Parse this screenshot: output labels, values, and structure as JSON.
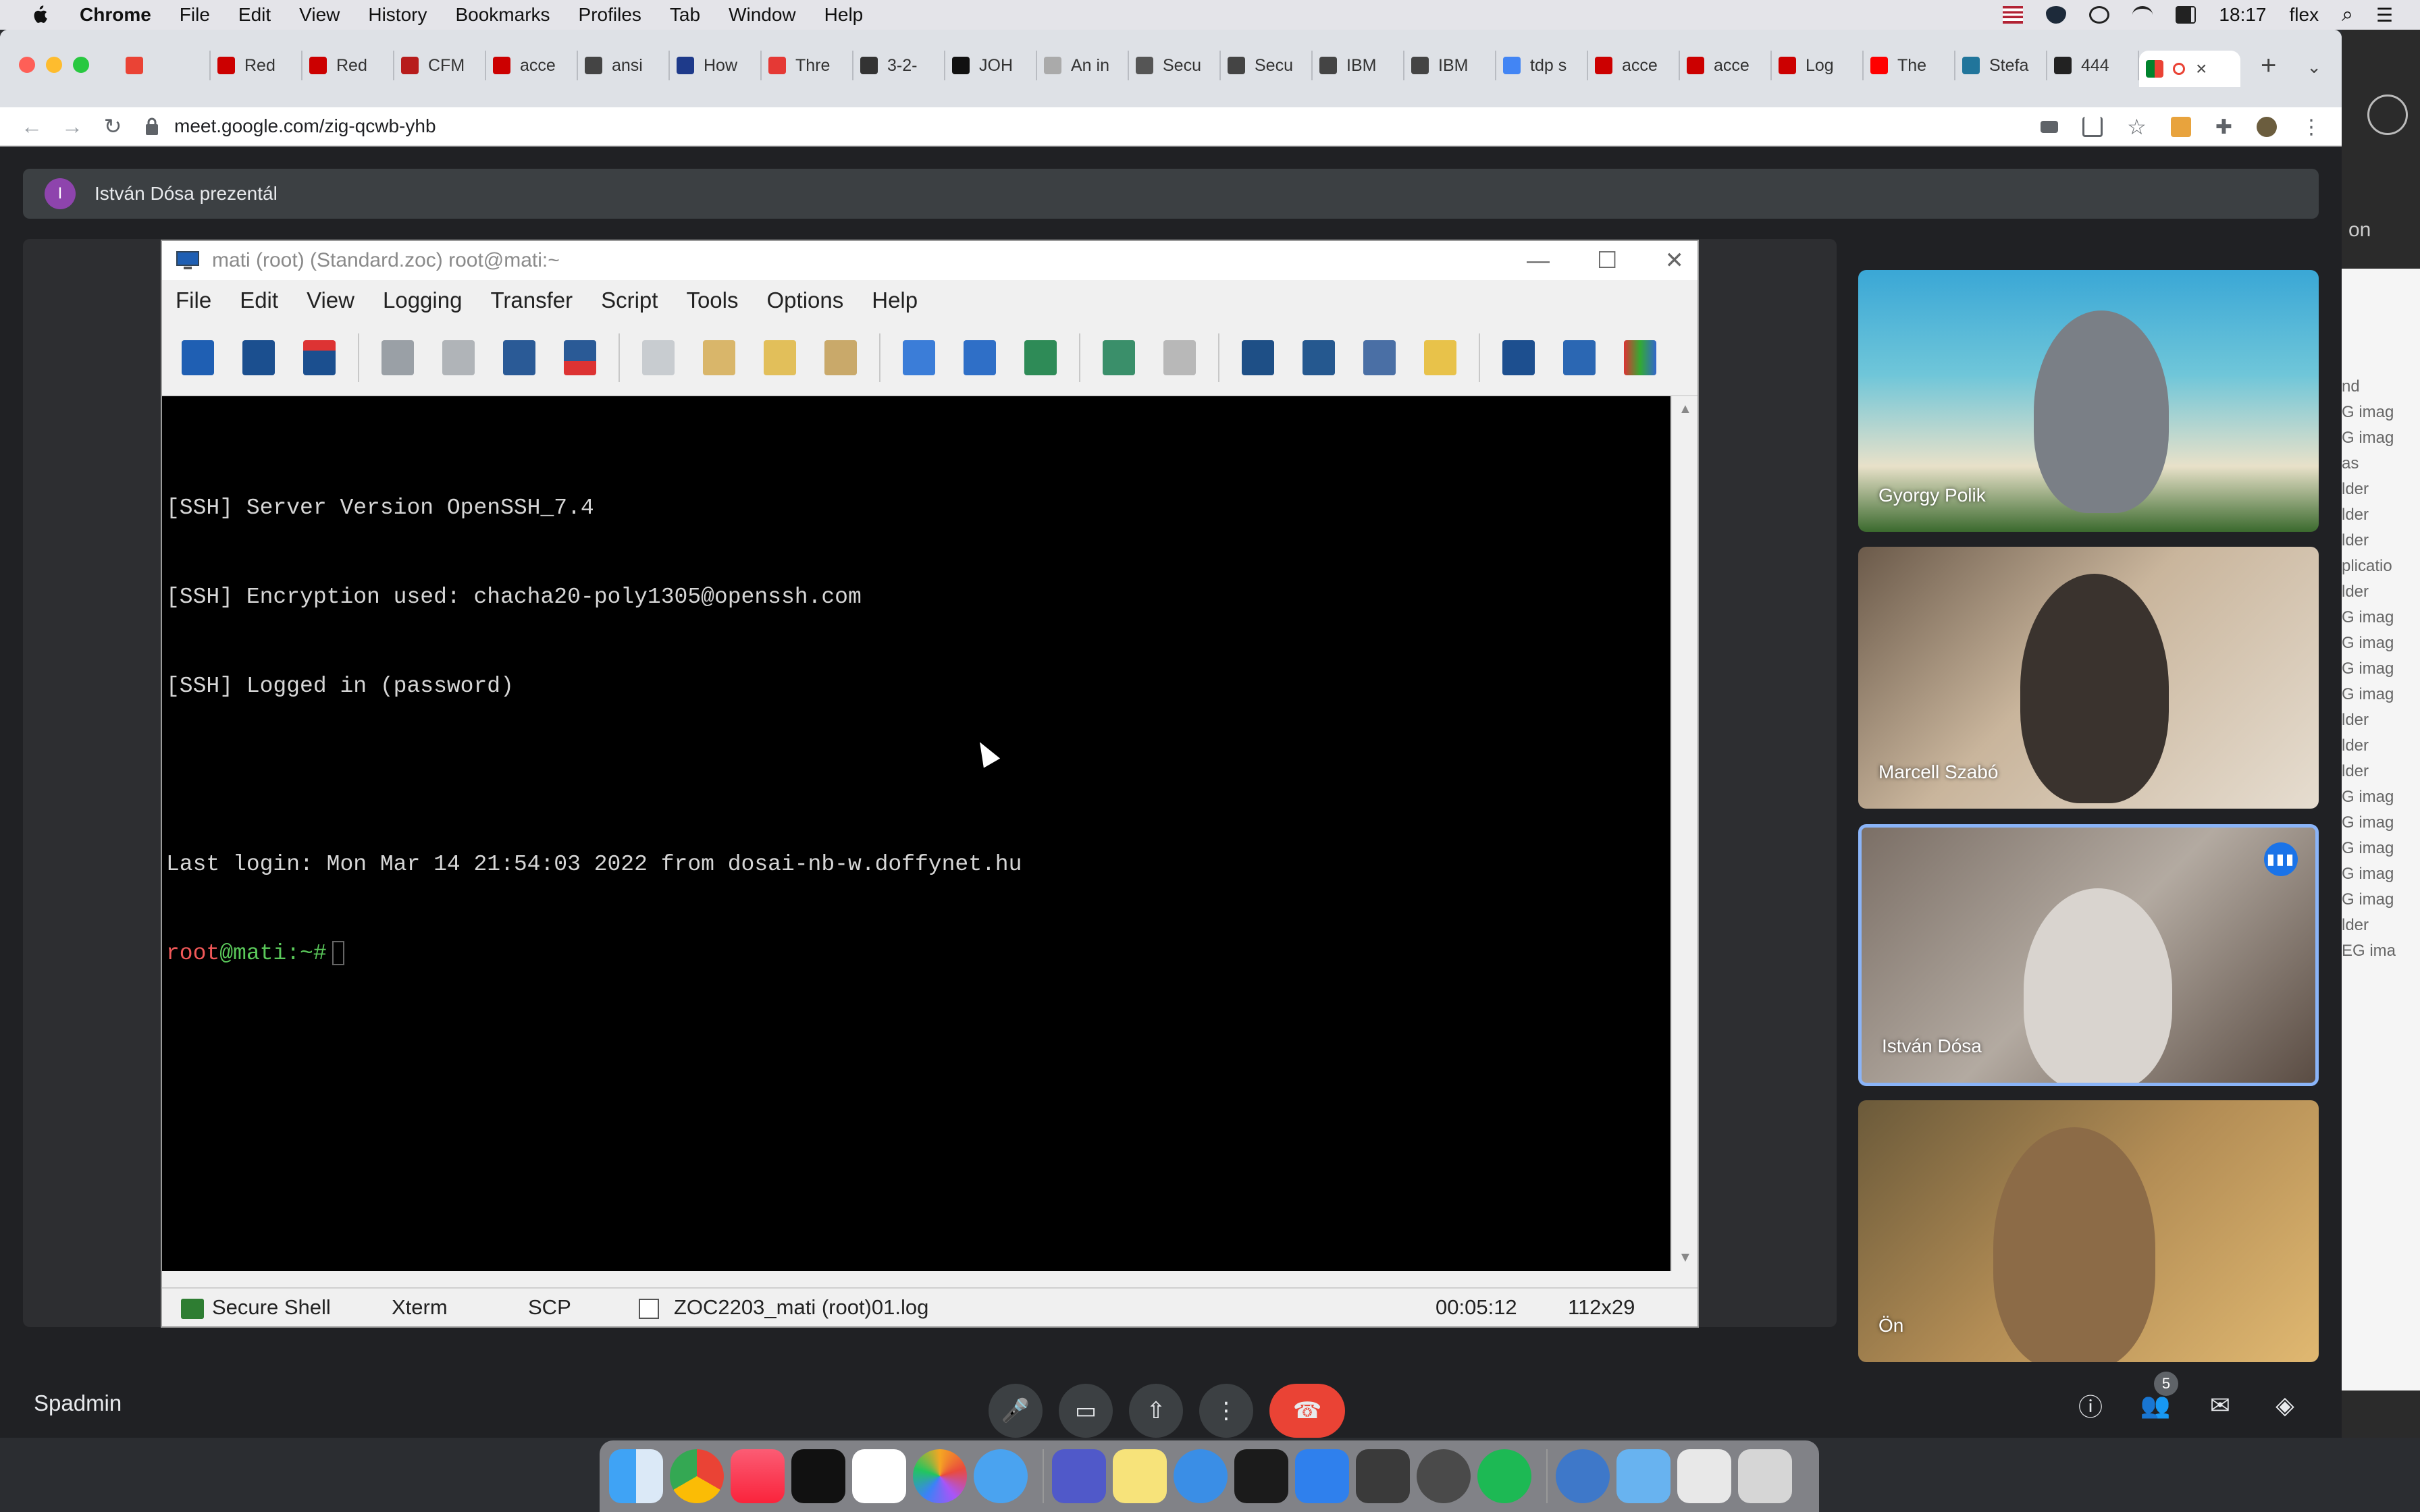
{
  "menubar": {
    "app": "Chrome",
    "items": [
      "File",
      "Edit",
      "View",
      "History",
      "Bookmarks",
      "Profiles",
      "Tab",
      "Window",
      "Help"
    ],
    "time": "18:17",
    "user": "flex"
  },
  "browser": {
    "tabs": [
      {
        "label": "",
        "color": "#ea4335"
      },
      {
        "label": "Red",
        "color": "#cc0000"
      },
      {
        "label": "Red",
        "color": "#cc0000"
      },
      {
        "label": "CFM",
        "color": "#b71c1c"
      },
      {
        "label": "acce",
        "color": "#cc0000"
      },
      {
        "label": "ansi",
        "color": "#444444"
      },
      {
        "label": "How",
        "color": "#1e3a8a"
      },
      {
        "label": "Thre",
        "color": "#e53935"
      },
      {
        "label": "3-2-",
        "color": "#333333"
      },
      {
        "label": "JOH",
        "color": "#111111"
      },
      {
        "label": "An in",
        "color": "#aaaaaa"
      },
      {
        "label": "Secu",
        "color": "#555555"
      },
      {
        "label": "Secu",
        "color": "#444444"
      },
      {
        "label": "IBM",
        "color": "#444444"
      },
      {
        "label": "IBM",
        "color": "#444444"
      },
      {
        "label": "tdp s",
        "color": "#4285f4"
      },
      {
        "label": "acce",
        "color": "#cc0000"
      },
      {
        "label": "acce",
        "color": "#cc0000"
      },
      {
        "label": "Log",
        "color": "#cc0000"
      },
      {
        "label": "The",
        "color": "#ff0000"
      },
      {
        "label": "Stefa",
        "color": "#21759b"
      },
      {
        "label": "444",
        "color": "#222222"
      }
    ],
    "active_tab_close": "×",
    "new_tab": "+",
    "url": "meet.google.com/zig-qcwb-yhb"
  },
  "meet": {
    "presenter_initial": "I",
    "presenter_text": "István Dósa prezentál",
    "meeting_name": "Spadmin",
    "participant_count": "5",
    "participants": [
      {
        "name": "Gyorgy Polik"
      },
      {
        "name": "Marcell Szabó"
      },
      {
        "name": "István Dósa"
      },
      {
        "name": "Ön"
      }
    ]
  },
  "zoc": {
    "title": "mati (root) (Standard.zoc) root@mati:~",
    "menu": [
      "File",
      "Edit",
      "View",
      "Logging",
      "Transfer",
      "Script",
      "Tools",
      "Options",
      "Help"
    ],
    "terminal_lines": [
      "[SSH] Server Version OpenSSH_7.4",
      "[SSH] Encryption used: chacha20-poly1305@openssh.com",
      "[SSH] Logged in (password)",
      "",
      "Last login: Mon Mar 14 21:54:03 2022 from dosai-nb-w.doffynet.hu"
    ],
    "prompt_user": "root",
    "prompt_host": "@mati",
    "prompt_suffix": ":~#",
    "status": {
      "connection": "Secure Shell",
      "emulation": "Xterm",
      "transfer": "SCP",
      "logfile": "ZOC2203_mati (root)01.log",
      "elapsed": "00:05:12",
      "size": "112x29"
    }
  },
  "background_app": {
    "on": "on",
    "rows": [
      "nd",
      "G imag",
      "G imag",
      "as",
      "lder",
      "lder",
      "lder",
      "plicatio",
      "lder",
      "G imag",
      "G imag",
      "G imag",
      "G imag",
      "lder",
      "lder",
      "lder",
      "G imag",
      "G imag",
      "G imag",
      "G imag",
      "G imag",
      "lder",
      "EG ima"
    ]
  },
  "colors": {
    "meet_bg": "#202124",
    "end_call": "#ea4335",
    "speaking_border": "#8ab4f8"
  }
}
